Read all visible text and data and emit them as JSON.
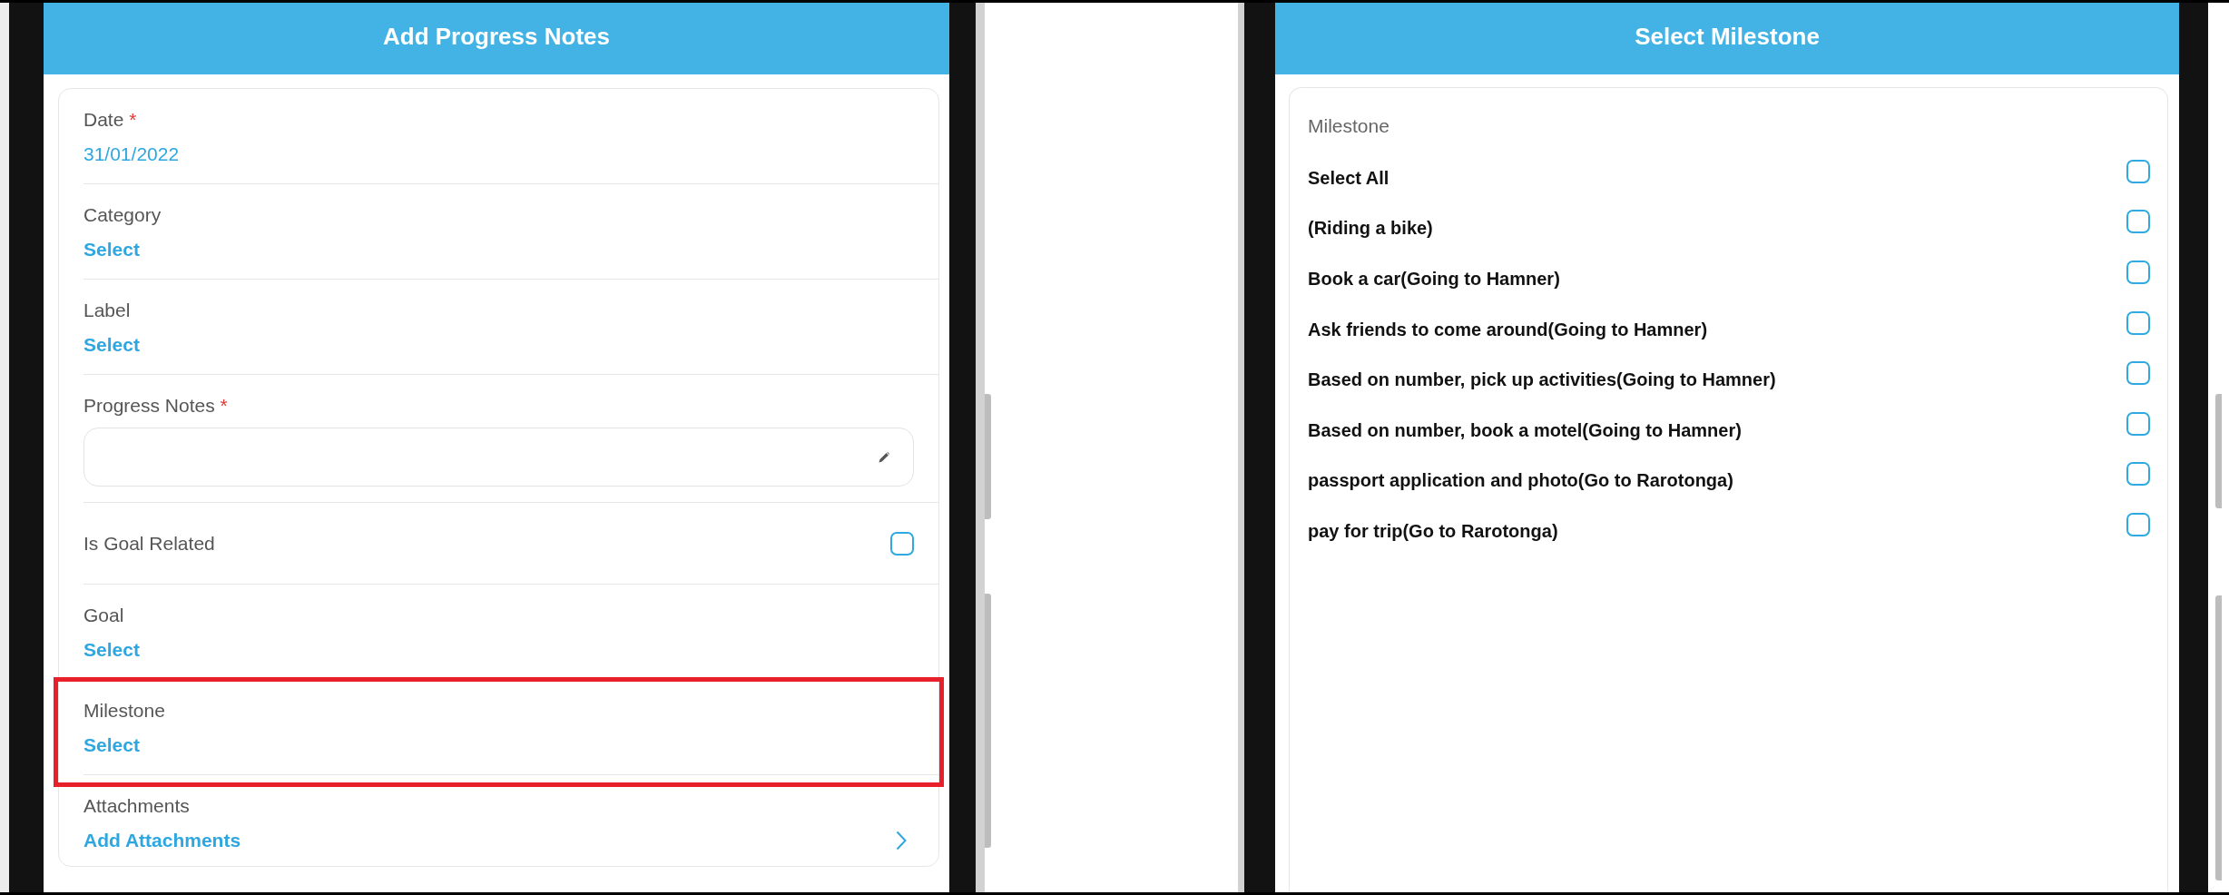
{
  "add_progress_notes": {
    "title": "Add Progress Notes",
    "fields": [
      {
        "kind": "value",
        "label": "Date",
        "required_mark": "*",
        "value": "31/01/2022",
        "highlighted": false
      },
      {
        "kind": "picker",
        "label": "Category",
        "value": "Select",
        "highlighted": false
      },
      {
        "kind": "picker",
        "label": "Label",
        "value": "Select",
        "highlighted": false
      },
      {
        "kind": "textarea",
        "label": "Progress Notes",
        "required_mark": "*",
        "highlighted": false
      },
      {
        "kind": "checkbox",
        "label": "Is Goal Related",
        "checked": false,
        "highlighted": false
      },
      {
        "kind": "picker",
        "label": "Goal",
        "value": "Select",
        "highlighted": false
      },
      {
        "kind": "picker",
        "label": "Milestone",
        "value": "Select",
        "highlighted": true
      },
      {
        "kind": "link",
        "label": "Attachments",
        "value": "Add Attachments",
        "highlighted": false
      }
    ]
  },
  "select_milestone": {
    "title": "Select Milestone",
    "section_label": "Milestone",
    "options": [
      {
        "label": "Select All",
        "checked": false
      },
      {
        "label": "(Riding a bike)",
        "checked": false
      },
      {
        "label": "Book a car(Going to Hamner)",
        "checked": false
      },
      {
        "label": "Ask friends to come around(Going to Hamner)",
        "checked": false
      },
      {
        "label": "Based on number, pick up activities(Going to Hamner)",
        "checked": false
      },
      {
        "label": "Based on number, book a motel(Going to Hamner)",
        "checked": false
      },
      {
        "label": "passport application and photo(Go to Rarotonga)",
        "checked": false
      },
      {
        "label": "pay for trip(Go to Rarotonga)",
        "checked": false
      }
    ]
  }
}
